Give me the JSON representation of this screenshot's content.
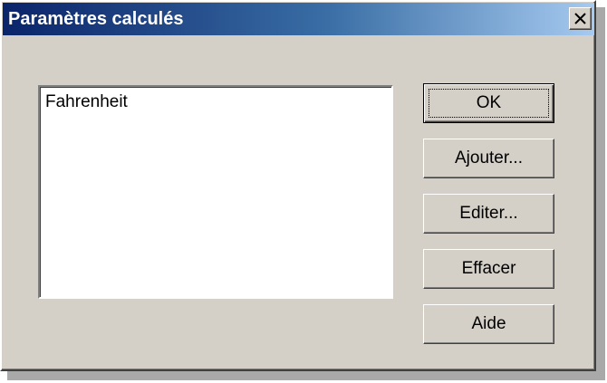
{
  "window": {
    "title": "Paramètres calculés",
    "close_icon": "close-icon"
  },
  "list": {
    "items": [
      "Fahrenheit"
    ]
  },
  "buttons": {
    "ok": "OK",
    "add": "Ajouter...",
    "edit": "Editer...",
    "delete": "Effacer",
    "help": "Aide"
  },
  "colors": {
    "title_start": "#0a246a",
    "title_end": "#a6caf0",
    "face": "#d4d0c8"
  }
}
